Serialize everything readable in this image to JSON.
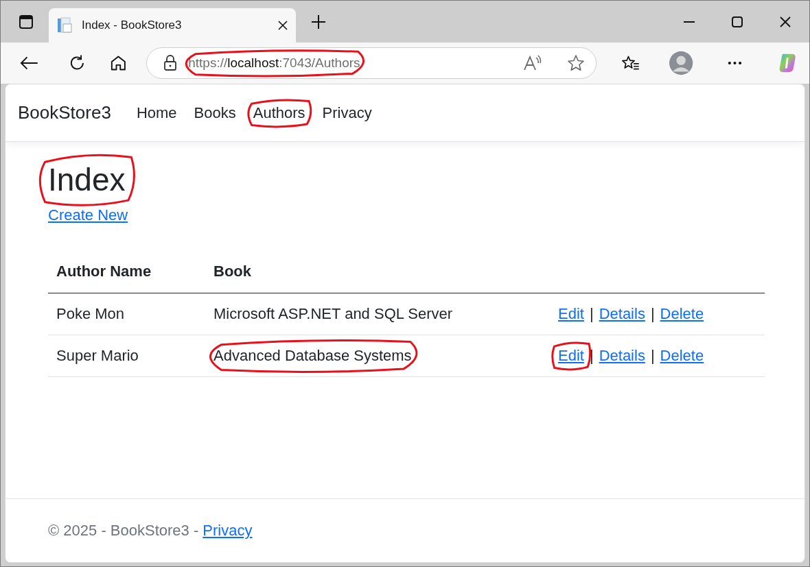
{
  "browser": {
    "tab": {
      "title": "Index - BookStore3",
      "selected": true
    },
    "address": {
      "scheme": "https://",
      "host": "localhost",
      "rest": ":7043/Authors",
      "circled": true
    }
  },
  "navbar": {
    "brand": "BookStore3",
    "links": [
      {
        "label": "Home",
        "circled": false
      },
      {
        "label": "Books",
        "circled": false
      },
      {
        "label": "Authors",
        "circled": true
      },
      {
        "label": "Privacy",
        "circled": false
      }
    ]
  },
  "heading": {
    "text": "Index",
    "circled": true
  },
  "create_link": "Create New",
  "table": {
    "columns": [
      "Author Name",
      "Book"
    ],
    "rows": [
      {
        "author": "Poke Mon",
        "book": "Microsoft ASP.NET and SQL Server",
        "book_circled": false,
        "separators": [
          "|",
          "|"
        ],
        "actions": [
          {
            "label": "Edit",
            "circled": false
          },
          {
            "label": "Details",
            "circled": false
          },
          {
            "label": "Delete",
            "circled": false
          }
        ]
      },
      {
        "author": "Super Mario",
        "book": "Advanced Database Systems",
        "book_circled": true,
        "separators": [
          "|",
          "|"
        ],
        "actions": [
          {
            "label": "Edit",
            "circled": true
          },
          {
            "label": "Details",
            "circled": false
          },
          {
            "label": "Delete",
            "circled": false
          }
        ]
      }
    ]
  },
  "footer": {
    "text": "© 2025 - BookStore3 - ",
    "link": "Privacy"
  }
}
